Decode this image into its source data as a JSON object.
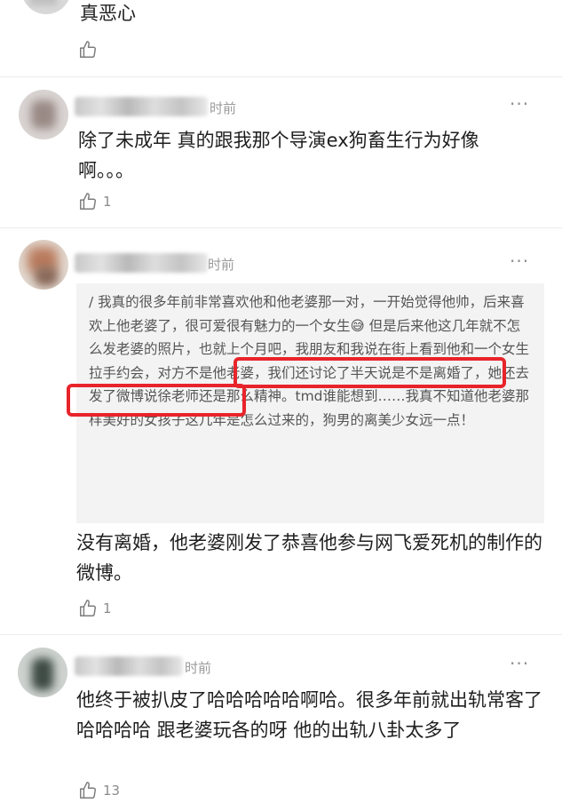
{
  "comments": [
    {
      "text": "真恶心",
      "likes": ""
    },
    {
      "time": "时前",
      "text": "除了未成年 真的跟我那个导演ex狗畜生行为好像啊。。。",
      "likes": "1"
    },
    {
      "time": "时前",
      "quote": "/ 我真的很多年前非常喜欢他和他老婆那一对，一开始觉得他帅，后来喜欢上他老婆了，很可爱很有魅力的一个女生😅 但是后来他这几年就不怎么发老婆的照片，也就上个月吧，我朋友和我说在街上看到他和一个女生拉手约会，对方不是他老婆，我们还讨论了半天说是不是离婚了，她还去发了微博说徐老师还是那么精神。tmd谁能想到……我真不知道他老婆那样美好的女孩子这几年是怎么过来的，狗男的离美少女远一点！",
      "text": "没有离婚，他老婆刚发了恭喜他参与网飞爱死机的制作的微博。",
      "likes": "1"
    },
    {
      "time": "时前",
      "text": "他终于被扒皮了哈哈哈哈哈啊哈。很多年前就出轨常客了哈哈哈哈 跟老婆玩各的呀 他的出轨八卦太多了",
      "likes": "13"
    }
  ],
  "icons": {
    "like": "thumbs-up-icon",
    "more": "more-dots-icon"
  },
  "colors": {
    "highlight": "#e8242b",
    "quote_bg": "#f3f3f3",
    "meta": "#9a9a9a"
  }
}
